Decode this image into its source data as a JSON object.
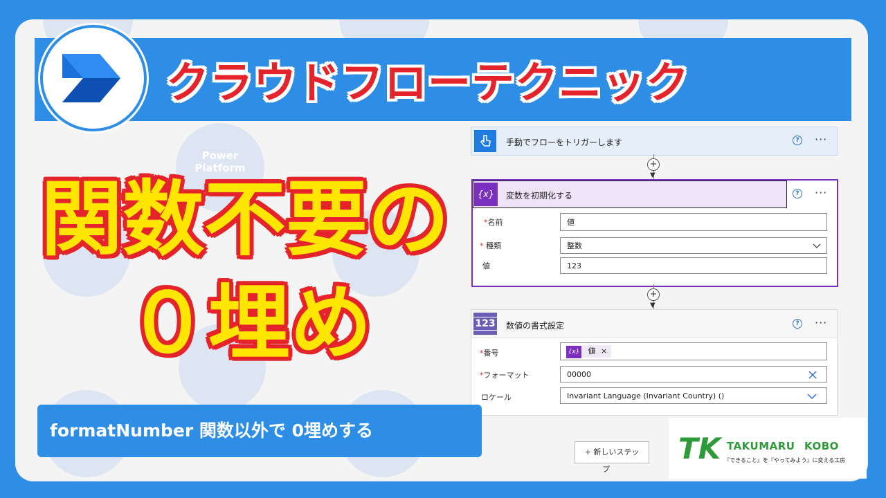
{
  "colors": {
    "brand_blue": "#2e8ee6",
    "title_red": "#e5232a",
    "highlight_yellow": "#ffe600",
    "variable_purple": "#7b2fbf",
    "trigger_blue": "#1f7ce0",
    "format_purple": "#6b5fb5",
    "logo_green": "#2f9a3a"
  },
  "header": {
    "title": "クラウドフローテクニック",
    "logo_icon": "power-automate-icon"
  },
  "background": {
    "circle_text_1": "Power",
    "circle_text_2": "Platform"
  },
  "headline": {
    "line1": "関数不要の",
    "line2": "０埋め"
  },
  "subtitle": "formatNumber 関数以外で 0埋めする",
  "flow": {
    "trigger": {
      "title": "手動でフローをトリガーします",
      "icon": "touch-icon"
    },
    "init_variable": {
      "title": "変数を初期化する",
      "icon_text": "{x}",
      "fields": [
        {
          "label": "名前",
          "required": true,
          "value": "値"
        },
        {
          "label": "種類",
          "required": true,
          "value": "整数"
        },
        {
          "label": "値",
          "required": false,
          "value": "123"
        }
      ]
    },
    "format_number": {
      "title": "数値の書式設定",
      "icon_text": "123",
      "fields": [
        {
          "label": "番号",
          "required": true,
          "token_icon": "{x}",
          "token_label": "値",
          "token_remove": "×"
        },
        {
          "label": "フォーマット",
          "required": true,
          "value": "00000"
        },
        {
          "label": "ロケール",
          "required": false,
          "value": "Invariant Language (Invariant Country) ()"
        }
      ]
    },
    "new_step_label": "+ 新しいステップ",
    "new_step_line1": "+ 新しいステッ",
    "new_step_line2": "プ",
    "help_glyph": "?",
    "more_glyph": "···",
    "plus_glyph": "+",
    "arrow_glyph": "▼"
  },
  "brand": {
    "name_1": "TAKUMARU",
    "name_2": "KOBO",
    "tagline": "『できること』を『やってみよう』に変える工房",
    "logo_letters": "TK"
  }
}
